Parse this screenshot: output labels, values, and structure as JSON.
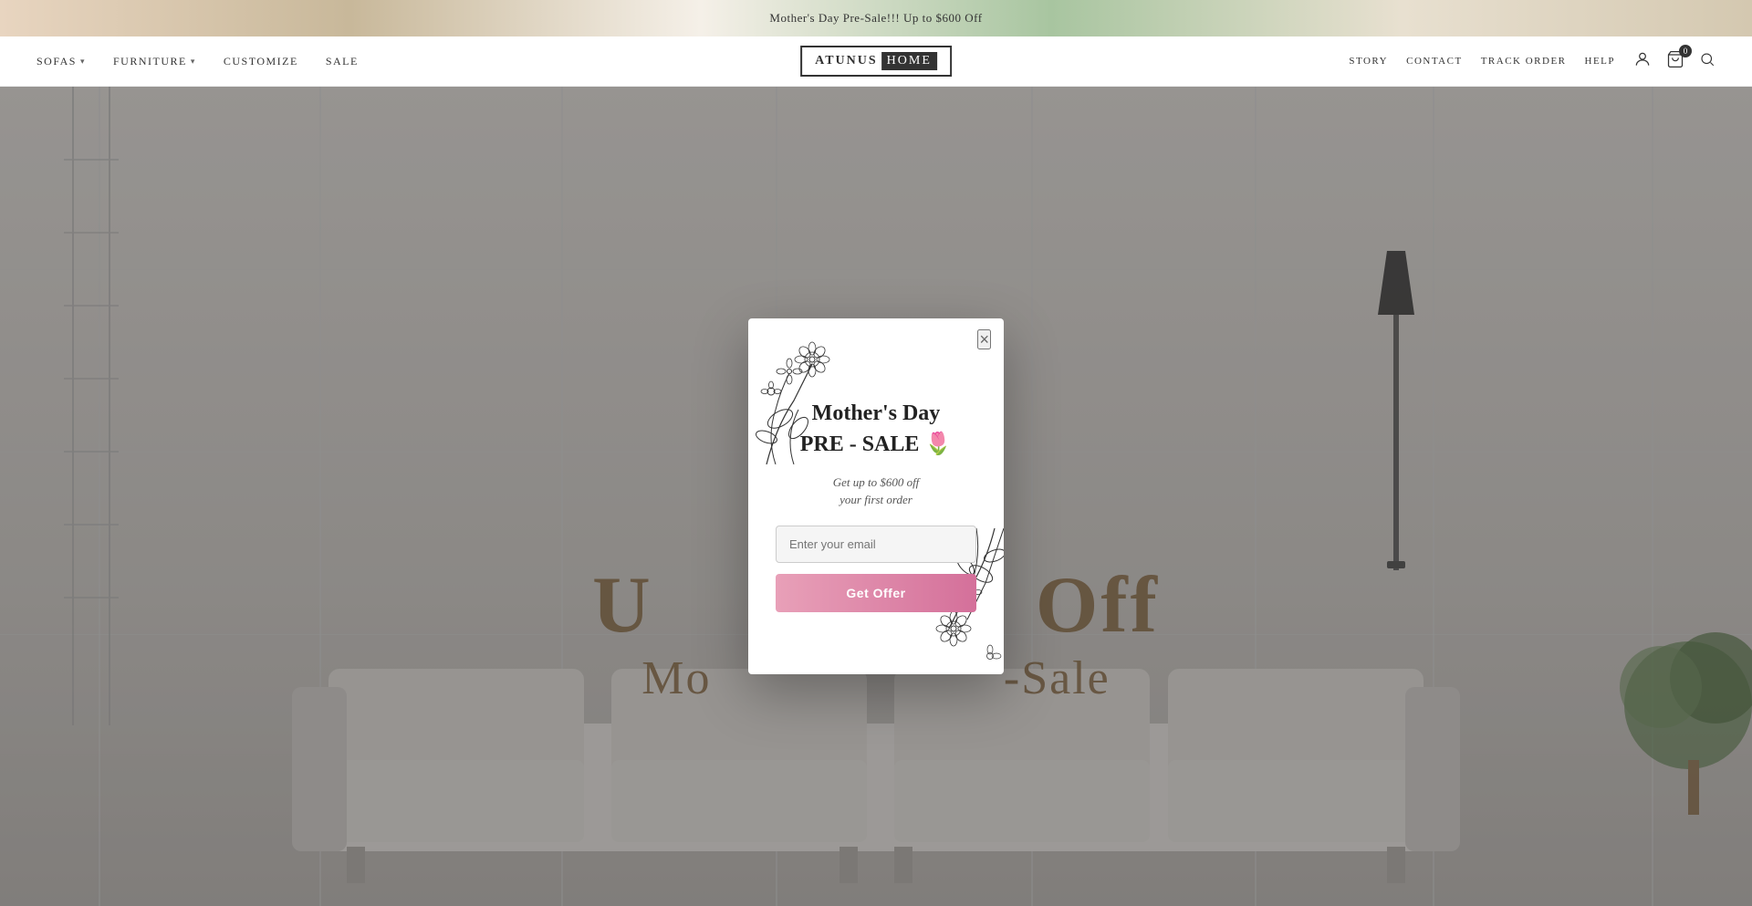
{
  "announcement": {
    "text": "Mother's Day Pre-Sale!!! Up to $600 Off"
  },
  "header": {
    "nav_left": [
      {
        "label": "SOFAS",
        "has_dropdown": true
      },
      {
        "label": "FURNITURE",
        "has_dropdown": true
      },
      {
        "label": "CUSTOMIZE",
        "has_dropdown": false
      },
      {
        "label": "SALE",
        "has_dropdown": false
      }
    ],
    "logo": {
      "part1": "ATUNUS",
      "part2": "HOME"
    },
    "nav_right": [
      {
        "label": "STORY"
      },
      {
        "label": "CONTACT"
      },
      {
        "label": "TRACK ORDER"
      },
      {
        "label": "HELP"
      }
    ],
    "cart_count": "0"
  },
  "hero": {
    "title_line1": "Up to $600",
    "title_line2": "Off",
    "subtitle": "Mother's Day Pre-Sale"
  },
  "modal": {
    "title_line1": "Mother's Day",
    "title_line2": "PRE - SALE 🌷",
    "subtitle_line1": "Get up to $600 off",
    "subtitle_line2": "your first order",
    "input_placeholder": "Enter your email",
    "button_label": "Get Offer",
    "close_label": "×"
  }
}
